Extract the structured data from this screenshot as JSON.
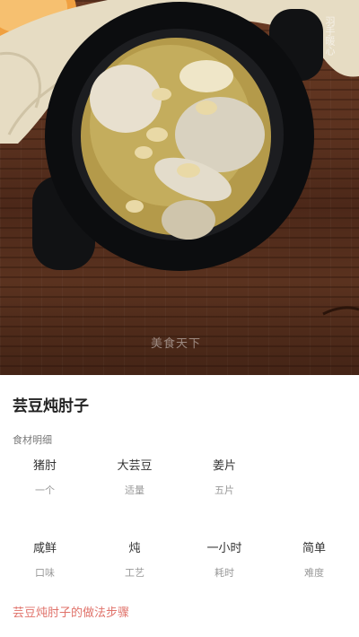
{
  "recipe": {
    "title": "芸豆炖肘子",
    "ingredients_label": "食材明细",
    "ingredients": [
      {
        "name": "猪肘",
        "amount": "一个"
      },
      {
        "name": "大芸豆",
        "amount": "适量"
      },
      {
        "name": "姜片",
        "amount": "五片"
      }
    ],
    "attributes": [
      {
        "value": "咸鲜",
        "label": "口味"
      },
      {
        "value": "炖",
        "label": "工艺"
      },
      {
        "value": "一小时",
        "label": "耗时"
      },
      {
        "value": "简单",
        "label": "难度"
      }
    ],
    "steps_link": "芸豆炖肘子的做法步骤"
  },
  "photo": {
    "watermark_corner": "羽手暖心",
    "watermark_bottom": "美食天下"
  }
}
